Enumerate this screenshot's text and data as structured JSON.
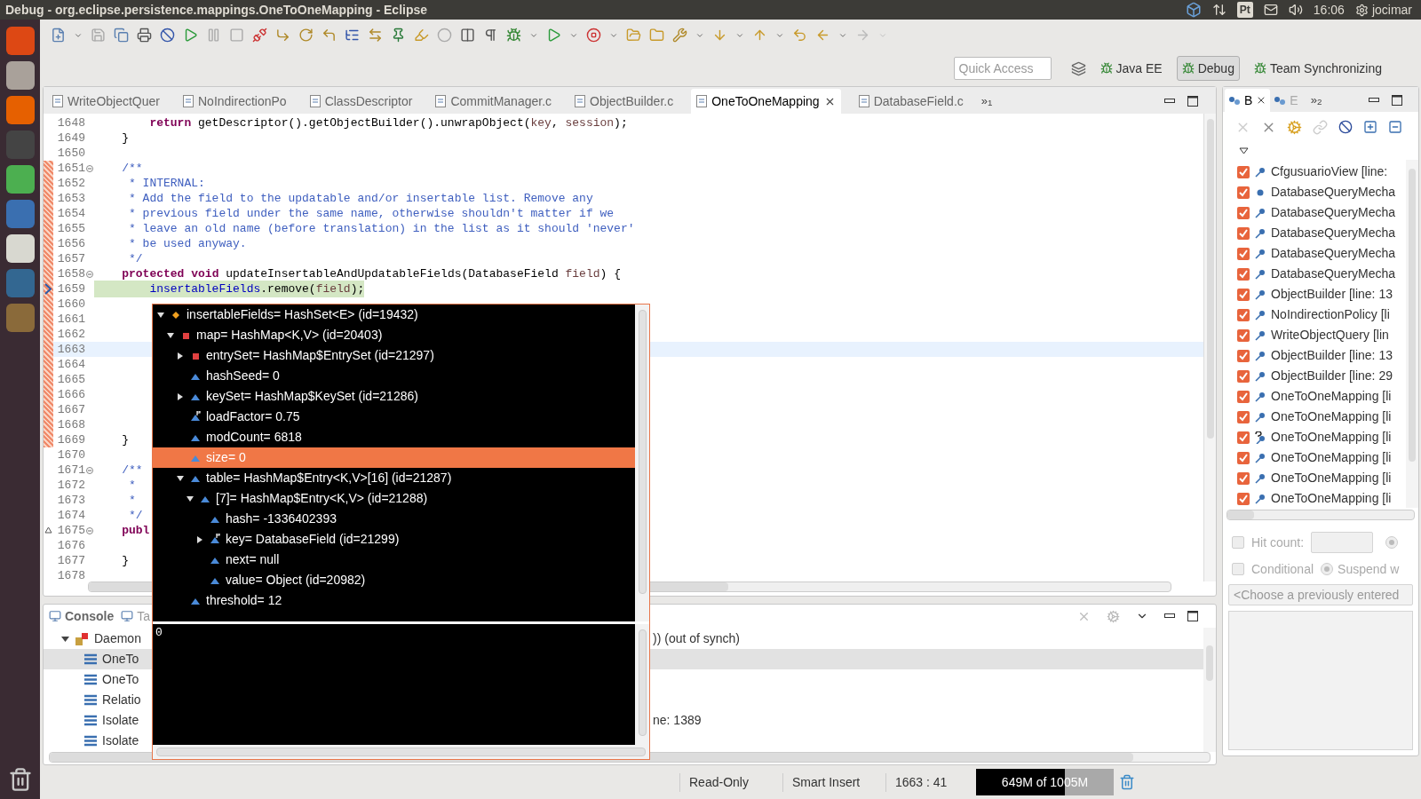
{
  "window": {
    "title": "Debug - org.eclipse.persistence.mappings.OneToOneMapping - Eclipse"
  },
  "top_bar": {
    "keyboard_layout": "Pt",
    "clock": "16:06",
    "user": "jocimar"
  },
  "quick_access": {
    "placeholder": "Quick Access"
  },
  "perspectives": [
    {
      "label": "Java EE",
      "selected": false
    },
    {
      "label": "Debug",
      "selected": true
    },
    {
      "label": "Team Synchronizing",
      "selected": false
    }
  ],
  "editor_tabs": [
    {
      "label": "WriteObjectQuer",
      "selected": false
    },
    {
      "label": "NoIndirectionPo",
      "selected": false
    },
    {
      "label": "ClassDescriptor",
      "selected": false
    },
    {
      "label": "CommitManager.c",
      "selected": false
    },
    {
      "label": "ObjectBuilder.c",
      "selected": false
    },
    {
      "label": "OneToOneMapping",
      "selected": true
    },
    {
      "label": "DatabaseField.c",
      "selected": false
    }
  ],
  "editor_tabs_overflow": "»$_{1}$",
  "editor": {
    "lines": [
      {
        "number": "1648",
        "marked": false,
        "fold": false,
        "pointer": false,
        "override": false,
        "current": false,
        "cursor": false,
        "tokens": [
          {
            "kind": "kw",
            "text": "        return"
          },
          {
            "kind": "tx",
            "text": " getDescriptor().getObjectBuilder().unwrapObject("
          },
          {
            "kind": "pm",
            "text": "key"
          },
          {
            "kind": "tx",
            "text": ", "
          },
          {
            "kind": "pm",
            "text": "session"
          },
          {
            "kind": "tx",
            "text": ");"
          }
        ]
      },
      {
        "number": "1649",
        "marked": false,
        "fold": false,
        "pointer": false,
        "override": false,
        "current": false,
        "cursor": false,
        "tokens": [
          {
            "kind": "tx",
            "text": "    }"
          }
        ]
      },
      {
        "number": "1650",
        "marked": false,
        "fold": false,
        "pointer": false,
        "override": false,
        "current": false,
        "cursor": false
      },
      {
        "number": "1651",
        "marked": true,
        "fold": true,
        "pointer": false,
        "override": false,
        "current": false,
        "cursor": false,
        "tokens": [
          {
            "kind": "cm",
            "text": "    /**"
          }
        ]
      },
      {
        "number": "1652",
        "marked": true,
        "fold": false,
        "pointer": false,
        "override": false,
        "current": false,
        "cursor": false,
        "tokens": [
          {
            "kind": "cm",
            "text": "     * INTERNAL:"
          }
        ]
      },
      {
        "number": "1653",
        "marked": true,
        "fold": false,
        "pointer": false,
        "override": false,
        "current": false,
        "cursor": false,
        "tokens": [
          {
            "kind": "cm",
            "text": "     * Add the field to the updatable and/or insertable list. Remove any"
          }
        ]
      },
      {
        "number": "1654",
        "marked": true,
        "fold": false,
        "pointer": false,
        "override": false,
        "current": false,
        "cursor": false,
        "tokens": [
          {
            "kind": "cm",
            "text": "     * previous field under the same name, otherwise shouldn't matter if we"
          }
        ]
      },
      {
        "number": "1655",
        "marked": true,
        "fold": false,
        "pointer": false,
        "override": false,
        "current": false,
        "cursor": false,
        "tokens": [
          {
            "kind": "cm",
            "text": "     * leave an old name (before translation) in the list as it should 'never'"
          }
        ]
      },
      {
        "number": "1656",
        "marked": true,
        "fold": false,
        "pointer": false,
        "override": false,
        "current": false,
        "cursor": false,
        "tokens": [
          {
            "kind": "cm",
            "text": "     * be used anyway."
          }
        ]
      },
      {
        "number": "1657",
        "marked": true,
        "fold": false,
        "pointer": false,
        "override": false,
        "current": false,
        "cursor": false,
        "tokens": [
          {
            "kind": "cm",
            "text": "     */"
          }
        ]
      },
      {
        "number": "1658",
        "marked": true,
        "fold": true,
        "pointer": false,
        "override": false,
        "current": false,
        "cursor": false,
        "tokens": [
          {
            "kind": "kw",
            "text": "    protected"
          },
          {
            "kind": "kw",
            "text": " void"
          },
          {
            "kind": "tx",
            "text": " updateInsertableAndUpdatableFields(DatabaseField "
          },
          {
            "kind": "pm",
            "text": "field"
          },
          {
            "kind": "tx",
            "text": ") {"
          }
        ]
      },
      {
        "number": "1659",
        "marked": true,
        "fold": false,
        "pointer": true,
        "override": false,
        "current": true,
        "cursor": false,
        "tokens": [
          {
            "kind": "fd",
            "text": "        insertableFields"
          },
          {
            "kind": "tx",
            "text": ".remove("
          },
          {
            "kind": "pm",
            "text": "field"
          },
          {
            "kind": "tx",
            "text": ");"
          }
        ]
      },
      {
        "number": "1660",
        "marked": true,
        "fold": false,
        "pointer": false,
        "override": false,
        "current": false,
        "cursor": false
      },
      {
        "number": "1661",
        "marked": true,
        "fold": false,
        "pointer": false,
        "override": false,
        "current": false,
        "cursor": false
      },
      {
        "number": "1662",
        "marked": true,
        "fold": false,
        "pointer": false,
        "override": false,
        "current": false,
        "cursor": false
      },
      {
        "number": "1663",
        "marked": true,
        "fold": false,
        "pointer": false,
        "override": false,
        "current": false,
        "cursor": true
      },
      {
        "number": "1664",
        "marked": true,
        "fold": false,
        "pointer": false,
        "override": false,
        "current": false,
        "cursor": false
      },
      {
        "number": "1665",
        "marked": true,
        "fold": false,
        "pointer": false,
        "override": false,
        "current": false,
        "cursor": false
      },
      {
        "number": "1666",
        "marked": true,
        "fold": false,
        "pointer": false,
        "override": false,
        "current": false,
        "cursor": false
      },
      {
        "number": "1667",
        "marked": true,
        "fold": false,
        "pointer": false,
        "override": false,
        "current": false,
        "cursor": false
      },
      {
        "number": "1668",
        "marked": true,
        "fold": false,
        "pointer": false,
        "override": false,
        "current": false,
        "cursor": false
      },
      {
        "number": "1669",
        "marked": true,
        "fold": false,
        "pointer": false,
        "override": false,
        "current": false,
        "cursor": false,
        "tokens": [
          {
            "kind": "tx",
            "text": "    }"
          }
        ]
      },
      {
        "number": "1670",
        "marked": false,
        "fold": false,
        "pointer": false,
        "override": false,
        "current": false,
        "cursor": false
      },
      {
        "number": "1671",
        "marked": false,
        "fold": true,
        "pointer": false,
        "override": false,
        "current": false,
        "cursor": false,
        "tokens": [
          {
            "kind": "cm",
            "text": "    /**"
          }
        ]
      },
      {
        "number": "1672",
        "marked": false,
        "fold": false,
        "pointer": false,
        "override": false,
        "current": false,
        "cursor": false,
        "tokens": [
          {
            "kind": "cm",
            "text": "     *"
          }
        ]
      },
      {
        "number": "1673",
        "marked": false,
        "fold": false,
        "pointer": false,
        "override": false,
        "current": false,
        "cursor": false,
        "tokens": [
          {
            "kind": "cm",
            "text": "     *"
          }
        ]
      },
      {
        "number": "1674",
        "marked": false,
        "fold": false,
        "pointer": false,
        "override": false,
        "current": false,
        "cursor": false,
        "tokens": [
          {
            "kind": "cm",
            "text": "     */"
          }
        ]
      },
      {
        "number": "1675",
        "marked": false,
        "fold": true,
        "pointer": false,
        "override": true,
        "current": false,
        "cursor": false,
        "tokens": [
          {
            "kind": "kw",
            "text": "    publ"
          }
        ]
      },
      {
        "number": "1676",
        "marked": false,
        "fold": false,
        "pointer": false,
        "override": false,
        "current": false,
        "cursor": false
      },
      {
        "number": "1677",
        "marked": false,
        "fold": false,
        "pointer": false,
        "override": false,
        "current": false,
        "cursor": false,
        "tokens": [
          {
            "kind": "tx",
            "text": "    }"
          }
        ]
      },
      {
        "number": "1678",
        "marked": false,
        "fold": false,
        "pointer": false,
        "override": false,
        "current": false,
        "cursor": false
      }
    ]
  },
  "variable_popup": {
    "tree": [
      {
        "label": "insertableFields= HashSet<E> (id=19432)",
        "kind": "protected",
        "final": false,
        "expanded": true,
        "selected": false,
        "children": [
          {
            "label": "map= HashMap<K,V> (id=20403)",
            "kind": "private",
            "final": false,
            "expanded": true,
            "selected": false,
            "children": [
              {
                "label": "entrySet= HashMap$EntrySet (id=21297)",
                "kind": "private",
                "final": false,
                "expanded": false,
                "selected": false
              },
              {
                "label": "hashSeed= 0",
                "kind": "default",
                "final": false,
                "selected": false
              },
              {
                "label": "keySet= HashMap$KeySet (id=21286)",
                "kind": "default",
                "final": false,
                "expanded": false,
                "selected": false
              },
              {
                "label": "loadFactor= 0.75",
                "kind": "default",
                "final": true,
                "selected": false
              },
              {
                "label": "modCount= 6818",
                "kind": "default",
                "final": false,
                "selected": false
              },
              {
                "label": "size= 0",
                "kind": "default",
                "final": false,
                "selected": true
              },
              {
                "label": "table= HashMap$Entry<K,V>[16] (id=21287)",
                "kind": "default",
                "final": false,
                "expanded": true,
                "selected": false,
                "children": [
                  {
                    "label": "[7]= HashMap$Entry<K,V> (id=21288)",
                    "kind": "default",
                    "final": false,
                    "expanded": true,
                    "selected": false,
                    "children": [
                      {
                        "label": "hash= -1336402393",
                        "kind": "default",
                        "final": false,
                        "selected": false
                      },
                      {
                        "label": "key= DatabaseField (id=21299)",
                        "kind": "default",
                        "final": true,
                        "expanded": false,
                        "selected": false
                      },
                      {
                        "label": "next= null",
                        "kind": "default",
                        "final": false,
                        "selected": false
                      },
                      {
                        "label": "value= Object (id=20982)",
                        "kind": "default",
                        "final": false,
                        "selected": false
                      }
                    ]
                  }
                ]
              },
              {
                "label": "threshold= 12",
                "kind": "default",
                "final": false,
                "selected": false
              }
            ]
          }
        ]
      }
    ],
    "detail": "0"
  },
  "bottom_panel": {
    "tabs": [
      {
        "label": "Console",
        "selected": true
      },
      {
        "label": "Ta",
        "selected": false
      }
    ],
    "rows": [
      {
        "label": "Daemon",
        "trailing": ")) (out of synch)",
        "expanded": true,
        "selected": false,
        "children": [
          {
            "label": "OneTo",
            "selected": true
          },
          {
            "label": "OneTo",
            "selected": false
          },
          {
            "label": "Relatio",
            "selected": false
          },
          {
            "label": "Isolate",
            "trailing": "ne: 1389",
            "selected": false
          },
          {
            "label": "Isolate",
            "selected": false
          }
        ]
      }
    ]
  },
  "breakpoints_panel": {
    "tabs": [
      {
        "label": "B",
        "selected": true
      },
      {
        "label": "E",
        "selected": false
      }
    ],
    "overflow": "»$_{2}$",
    "items": [
      {
        "label": "CfgusuarioView [line:",
        "checked": true,
        "kind": "line"
      },
      {
        "label": "DatabaseQueryMecha",
        "checked": true,
        "kind": "method"
      },
      {
        "label": "DatabaseQueryMecha",
        "checked": true,
        "kind": "line"
      },
      {
        "label": "DatabaseQueryMecha",
        "checked": true,
        "kind": "line"
      },
      {
        "label": "DatabaseQueryMecha",
        "checked": true,
        "kind": "line"
      },
      {
        "label": "DatabaseQueryMecha",
        "checked": true,
        "kind": "line"
      },
      {
        "label": "ObjectBuilder [line: 13",
        "checked": true,
        "kind": "line"
      },
      {
        "label": "NoIndirectionPolicy [li",
        "checked": true,
        "kind": "line"
      },
      {
        "label": "WriteObjectQuery [lin",
        "checked": true,
        "kind": "line"
      },
      {
        "label": "ObjectBuilder [line: 13",
        "checked": true,
        "kind": "line"
      },
      {
        "label": "ObjectBuilder [line: 29",
        "checked": true,
        "kind": "line"
      },
      {
        "label": "OneToOneMapping [li",
        "checked": true,
        "kind": "line"
      },
      {
        "label": "OneToOneMapping [li",
        "checked": true,
        "kind": "line"
      },
      {
        "label": "OneToOneMapping [li",
        "checked": true,
        "kind": "conditional"
      },
      {
        "label": "OneToOneMapping [li",
        "checked": true,
        "kind": "line"
      },
      {
        "label": "OneToOneMapping [li",
        "checked": true,
        "kind": "line"
      },
      {
        "label": "OneToOneMapping [li",
        "checked": true,
        "kind": "line"
      }
    ],
    "hit_count": {
      "label": "Hit count:",
      "checked": false,
      "disabled": true
    },
    "hit_count_radio": {
      "selected": true,
      "disabled": true
    },
    "conditional": {
      "label": "Conditional",
      "checked": false,
      "disabled": true
    },
    "suspend": {
      "label": "Suspend w",
      "selected": true,
      "disabled": true
    },
    "condition_combo": {
      "value": "<Choose a previously entered"
    }
  },
  "status_bar": {
    "mode": "Read-Only",
    "insert_mode": "Smart Insert",
    "position": "1663 : 41",
    "memory": {
      "text": "649M of 1005M",
      "level": 0.646
    }
  }
}
